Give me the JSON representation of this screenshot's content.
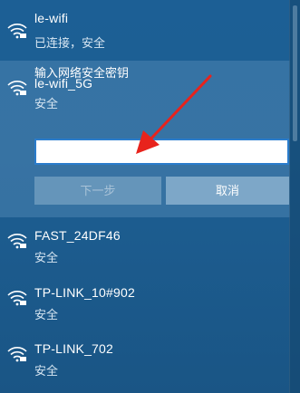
{
  "networks": [
    {
      "ssid": "le-wifi",
      "status": "已连接，安全",
      "icon": "wifi-secured-icon"
    },
    {
      "ssid": "le-wifi_5G",
      "status": "安全",
      "icon": "wifi-secured-icon"
    },
    {
      "ssid": "FAST_24DF46",
      "status": "安全",
      "icon": "wifi-secured-icon"
    },
    {
      "ssid": "TP-LINK_10#902",
      "status": "安全",
      "icon": "wifi-secured-icon"
    },
    {
      "ssid": "TP-LINK_702",
      "status": "安全",
      "icon": "wifi-secured-icon"
    }
  ],
  "password_prompt": {
    "label": "输入网络安全密钥",
    "value": ""
  },
  "buttons": {
    "next": "下一步",
    "cancel": "取消"
  },
  "annotation": {
    "type": "red-arrow",
    "color": "#e8231c"
  },
  "colors": {
    "panel_bg": "#1c5f95",
    "expanded_bg": "#4c84b0",
    "input_border": "#2a7ccb"
  }
}
